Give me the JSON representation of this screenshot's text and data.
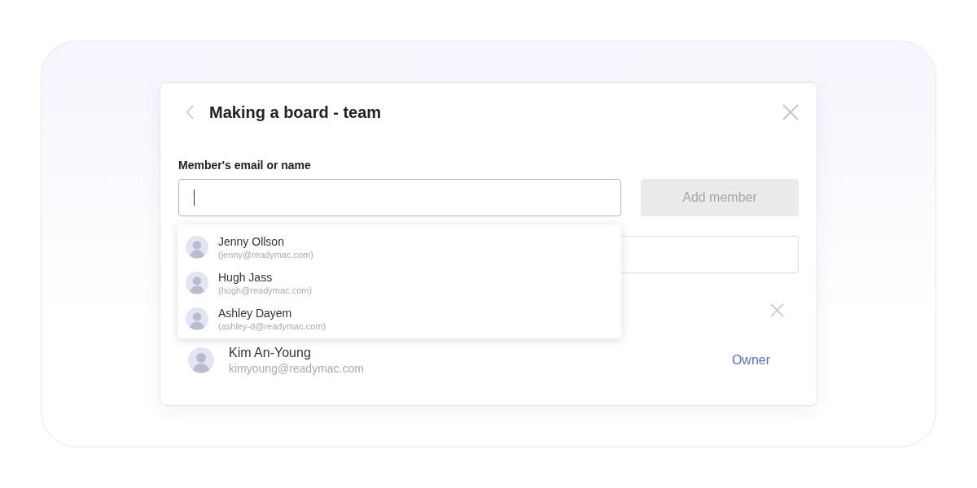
{
  "dialog": {
    "title": "Making a board - team"
  },
  "field": {
    "label": "Member's email or name",
    "focused": true
  },
  "add_button": {
    "label": "Add member",
    "disabled": true
  },
  "suggestions": [
    {
      "name": "Jenny Ollson",
      "email": "(jenny@readymac.com)"
    },
    {
      "name": "Hugh Jass",
      "email": "(hugh@readymac.com)"
    },
    {
      "name": "Ashley Dayem",
      "email": "(ashley-d@readymac.com)"
    }
  ],
  "members": [
    {
      "kind": "removable"
    },
    {
      "kind": "owner",
      "name": "Kim An-Young",
      "email": "kimyoung@readymac.com",
      "role": "Owner"
    }
  ]
}
